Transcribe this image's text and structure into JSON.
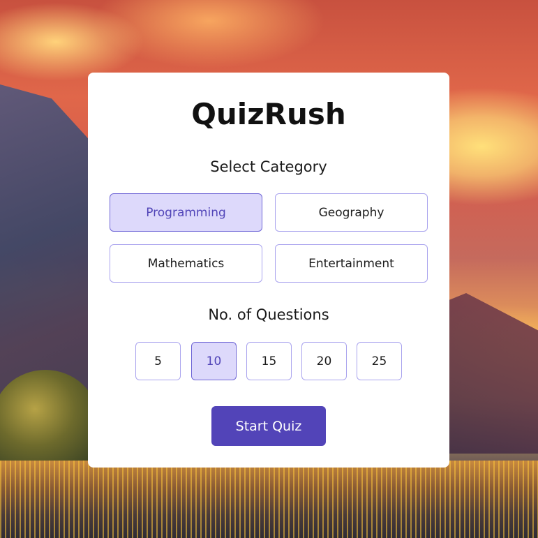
{
  "app": {
    "title": "QuizRush"
  },
  "category_section": {
    "heading": "Select Category",
    "selected": "Programming",
    "options": [
      {
        "label": "Programming"
      },
      {
        "label": "Geography"
      },
      {
        "label": "Mathematics"
      },
      {
        "label": "Entertainment"
      }
    ]
  },
  "questions_section": {
    "heading": "No. of Questions",
    "selected": "10",
    "options": [
      {
        "label": "5"
      },
      {
        "label": "10"
      },
      {
        "label": "15"
      },
      {
        "label": "20"
      },
      {
        "label": "25"
      }
    ]
  },
  "start_button": {
    "label": "Start Quiz"
  },
  "colors": {
    "accent": "#5244b8",
    "selected_background": "#ddd9fb",
    "option_border": "#a9a3ee",
    "card_background": "#ffffff"
  }
}
